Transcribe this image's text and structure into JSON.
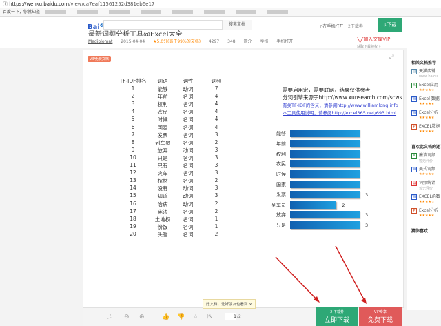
{
  "browser": {
    "url_host": "https://wenku.baidu.com",
    "url_path": "/view/ca7eaf11561252d381eb6e17",
    "bookmark_first": "百度一下，你就知道"
  },
  "header": {
    "logo_text": "Bai",
    "logo_suffix": "文库",
    "search_button": "搜索文档",
    "open_phone": "在手机打开",
    "download_count": "2下载券",
    "download_button": "下载"
  },
  "title": {
    "text": "最新词频分析工具@Excel大全",
    "author": "Mediplomat",
    "date": "2015-04-04",
    "rating": "★5.0分(高于99%的文档)",
    "views": "4297",
    "downloads": "348",
    "intro": "简介",
    "report": "举报",
    "phone_open": "手机打开",
    "vip_title": "加入文库VIP",
    "vip_sub": "获取下载特权 »"
  },
  "doc": {
    "badge": "VIP免费文档",
    "table": {
      "headers": [
        "TF-IDF排名",
        "词语",
        "词性",
        "词频"
      ],
      "rows": [
        [
          "1",
          "能够",
          "动词",
          "7"
        ],
        [
          "2",
          "年前",
          "名词",
          "4"
        ],
        [
          "3",
          "权利",
          "名词",
          "4"
        ],
        [
          "4",
          "农民",
          "名词",
          "4"
        ],
        [
          "5",
          "时候",
          "名词",
          "4"
        ],
        [
          "6",
          "国家",
          "名词",
          "4"
        ],
        [
          "7",
          "发票",
          "名词",
          "3"
        ],
        [
          "8",
          "列车员",
          "名词",
          "2"
        ],
        [
          "9",
          "放弃",
          "动词",
          "3"
        ],
        [
          "10",
          "只是",
          "名词",
          "3"
        ],
        [
          "11",
          "只有",
          "名词",
          "3"
        ],
        [
          "12",
          "火车",
          "名词",
          "3"
        ],
        [
          "13",
          "棺材",
          "名词",
          "2"
        ],
        [
          "14",
          "没有",
          "动词",
          "3"
        ],
        [
          "15",
          "知道",
          "动词",
          "3"
        ],
        [
          "16",
          "治病",
          "动词",
          "2"
        ],
        [
          "17",
          "宪法",
          "名词",
          "2"
        ],
        [
          "18",
          "土地权",
          "名词",
          "1"
        ],
        [
          "19",
          "份饭",
          "名词",
          "1"
        ],
        [
          "20",
          "头脑",
          "名词",
          "2"
        ]
      ]
    },
    "notes": [
      "需要启用宏，需要联网，结果仅供参考",
      "分词引擎来源于http://www.xunsearch.com/scws",
      "有关TF-IDF的含义，请参阅http://www.williamlong.info",
      "本工具使用说明，请参阅http://excel365.net/693.html"
    ]
  },
  "chart_data": {
    "type": "bar",
    "orientation": "horizontal",
    "categories": [
      "能够",
      "年前",
      "权利",
      "农民",
      "时候",
      "国家",
      "发票",
      "列车员",
      "放弃",
      "只是"
    ],
    "values": [
      7,
      4,
      4,
      4,
      4,
      4,
      3,
      2,
      3,
      3
    ],
    "data_labels": [
      "",
      "",
      "",
      "",
      "",
      "",
      "3",
      "2",
      "3",
      "3"
    ],
    "xlim": [
      0,
      3
    ],
    "colors": [
      "#1060b0",
      "#1ea0e0"
    ]
  },
  "sidebar": {
    "related_title": "相关文档推荐",
    "related": [
      {
        "icon": "web",
        "name": "天猫店铺",
        "sub": "www.baidu..."
      },
      {
        "icon": "X",
        "name": "Excel应用",
        "stars": "★★★★☆"
      },
      {
        "icon": "W",
        "name": "Excel 数据",
        "stars": "★★★★★"
      },
      {
        "icon": "W",
        "name": "Excel分析",
        "stars": "★★★★★"
      },
      {
        "icon": "P",
        "name": "EXCEL数据",
        "stars": "★★★★★"
      }
    ],
    "liked_title": "喜欢此文档的还喜欢",
    "liked": [
      {
        "icon": "X",
        "name": "廉洁词频",
        "sub": "暂无评价"
      },
      {
        "icon": "W",
        "name": "美式词频",
        "stars": "★★★★★"
      },
      {
        "icon": "PDF",
        "name": "词频统计",
        "sub": "暂无评价"
      },
      {
        "icon": "W",
        "name": "EXCEL函数",
        "stars": "★★★★☆"
      },
      {
        "icon": "P",
        "name": "Excel分析",
        "stars": "★★★★★"
      }
    ],
    "guess_title": "猜你喜欢"
  },
  "toolbar": {
    "page_current": "1",
    "page_total": "/2",
    "tip": "好文档，让好朋友也看到",
    "tip_close": "×"
  },
  "actions": {
    "download_sub": "2 下载券",
    "download_main": "立即下载",
    "vip_sub": "VIP专享",
    "vip_main": "免费下载"
  },
  "colors": {
    "green": "#2ea876",
    "red": "#e05a5a",
    "arrow": "#d02020"
  }
}
